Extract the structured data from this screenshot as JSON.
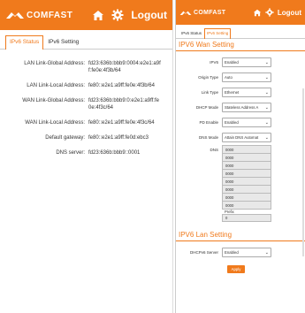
{
  "brand": {
    "name": "COMFAST",
    "accent": "#f07a1c"
  },
  "left": {
    "logout_label": "Logout",
    "tabs": [
      {
        "label": "IPv6 Status",
        "active": true
      },
      {
        "label": "IPv6 Setting",
        "active": false
      }
    ],
    "status_rows": [
      {
        "label": "LAN Link-Global Address:",
        "value": "fd23:636b:bbb9:0004:e2e1:a9ff:fe0e:4f3b/64"
      },
      {
        "label": "LAN Link-Local Address:",
        "value": "fe80::e2e1:a9ff:fe0e:4f3b/64"
      },
      {
        "label": "WAN Link-Global Address:",
        "value": "fd23:636b:bbb9:0:e2e1:a9ff:fe0e:4f3c/64"
      },
      {
        "label": "WAN Link-Local Address:",
        "value": "fe80::e2e1:a9ff:fe0e:4f3c/64"
      },
      {
        "label": "Default gateway:",
        "value": "fe80::e2e1:a9ff:fe0d:ebc3"
      },
      {
        "label": "DNS server:",
        "value": "fd23:636b:bbb9::0001"
      }
    ]
  },
  "right": {
    "logout_label": "Logout",
    "tabs": [
      {
        "label": "IPv6 Status",
        "active": false
      },
      {
        "label": "IPv6 Setting",
        "active": true
      }
    ],
    "wan_title": "IPV6 Wan Setting",
    "fields": [
      {
        "label": "IPV6",
        "value": "Enabled"
      },
      {
        "label": "Origin Type",
        "value": "Auto"
      },
      {
        "label": "Link Type",
        "value": "Ethernet"
      },
      {
        "label": "DHCP Mode",
        "value": "Stateless Address A"
      },
      {
        "label": "PD Enable",
        "value": "Enabled"
      },
      {
        "label": "DNS Mode",
        "value": "Attain DNS Automat"
      }
    ],
    "dns_label": "DNS",
    "dns_values": [
      "0000",
      "0000",
      "0000",
      "0000",
      "0000",
      "0000",
      "0000",
      "0000"
    ],
    "prefix_label": "Prefix",
    "prefix_value": "0",
    "lan_title": "IPV6 Lan Setting",
    "dhcpv6_label": "DHCPv6 Server",
    "dhcpv6_value": "Enabled",
    "apply_label": "Apply"
  }
}
